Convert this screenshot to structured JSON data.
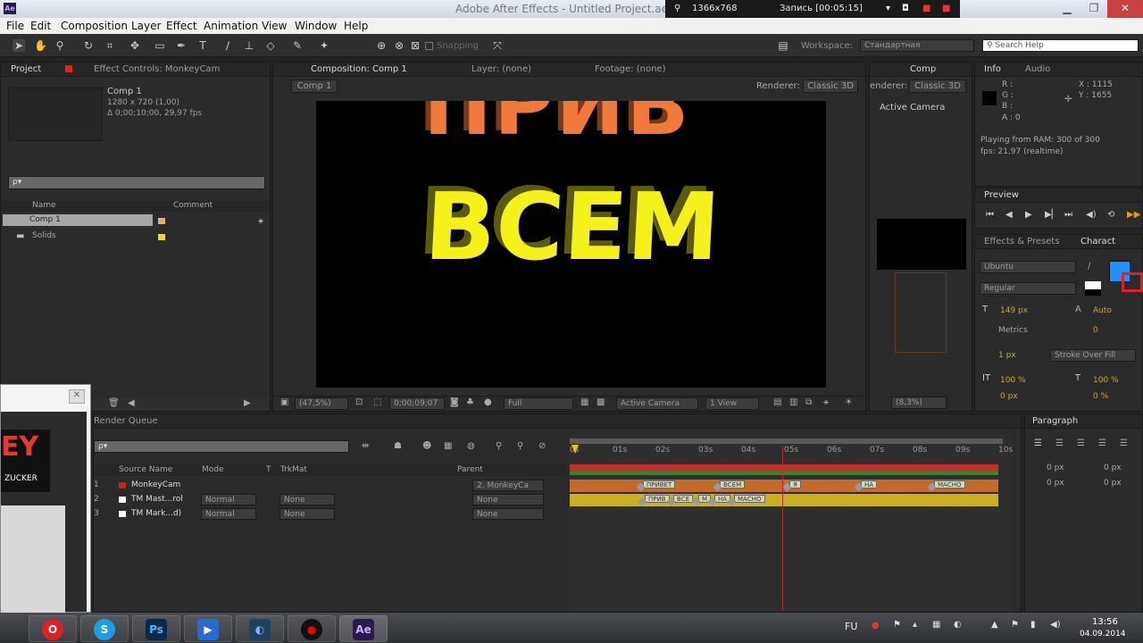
{
  "window": {
    "title": "Adobe After Effects - Untitled Project.aep",
    "app_icon": "Ae"
  },
  "recorder": {
    "resolution": "1366x768",
    "status": "Запись [00:05:15]"
  },
  "menu": [
    "File",
    "Edit",
    "Composition",
    "Layer",
    "Effect",
    "Animation",
    "View",
    "Window",
    "Help"
  ],
  "toolbar": {
    "snapping_label": "Snapping",
    "workspace_label": "Workspace:",
    "workspace_value": "Стандартная",
    "search_placeholder": "Search Help"
  },
  "project": {
    "tab": "Project",
    "tab2": "Effect Controls: MonkeyCam",
    "comp_name": "Comp 1",
    "comp_size": "1280 x 720 (1,00)",
    "comp_duration": "Δ 0;00;10;00, 29,97 fps",
    "search_placeholder": "ρ▾",
    "col_name": "Name",
    "col_comment": "Comment",
    "items": [
      "Comp 1",
      "Solids"
    ]
  },
  "comp": {
    "tab": "Composition: Comp 1",
    "tab_layer": "Layer: (none)",
    "tab_footage": "Footage: (none)",
    "subtab": "Comp 1",
    "renderer_label": "Renderer:",
    "renderer_value": "Classic 3D",
    "text_top": "ПРИВ",
    "text_main": "ВСЕМ",
    "zoom": "(47,5%)",
    "timecode": "0;00;09;07",
    "resolution": "Full",
    "view": "Active Camera",
    "views": "1 View"
  },
  "comp2": {
    "tab": "Comp",
    "renderer_label": "enderer:",
    "renderer_value": "Classic 3D",
    "camera": "Active Camera",
    "zoom": "(8,3%)"
  },
  "info": {
    "tab": "Info",
    "tab2": "Audio",
    "r": "R :",
    "g": "G :",
    "b": "B :",
    "a": "A : 0",
    "x": "X : 1115",
    "y": "Y : 1655",
    "status1": "Playing from RAM: 300 of 300",
    "status2": "fps: 21,97 (realtime)"
  },
  "preview": {
    "tab": "Preview"
  },
  "character": {
    "tab": "Effects & Presets",
    "tab2": "Charact",
    "font": "Ubuntu",
    "style": "Regular",
    "size": "149 px",
    "leading": "Auto",
    "kerning": "Metrics",
    "tracking": "0",
    "stroke": "1 px",
    "stroke_type": "Stroke Over Fill",
    "vscale": "100 %",
    "hscale": "100 %",
    "baseline": "0 px",
    "tsume": "0 %",
    "fill_color": "#1e90ff",
    "stroke_color": "#e02020"
  },
  "paragraph": {
    "tab": "Paragraph",
    "indent1": "0 px",
    "indent2": "0 px",
    "indent3": "0 px",
    "indent4": "0 px"
  },
  "render_queue": {
    "tab": "Render Queue",
    "search_placeholder": "ρ▾"
  },
  "timeline": {
    "col_source": "Source Name",
    "col_mode": "Mode",
    "col_t": "T",
    "col_trkmat": "TrkMat",
    "col_parent": "Parent",
    "layers": [
      {
        "num": "1",
        "name": "MonkeyCam",
        "mode": "",
        "trkmat": "",
        "parent": "2. MonkeyCa",
        "color": "#b02a2a"
      },
      {
        "num": "2",
        "name": "TM Mast...rol",
        "mode": "Normal",
        "trkmat": "None",
        "parent": "None",
        "color": "#c8761b"
      },
      {
        "num": "3",
        "name": "TM Mark...d)",
        "mode": "Normal",
        "trkmat": "None",
        "parent": "None",
        "color": "#c8b021"
      }
    ],
    "ruler": [
      "0s",
      "01s",
      "02s",
      "03s",
      "04s",
      "05s",
      "06s",
      "07s",
      "08s",
      "09s",
      "10s"
    ],
    "markers2": [
      "ПРИВЕТ",
      "ВСЕМ",
      "Я",
      "НА",
      "МАСНО"
    ],
    "markers3": [
      "ПРИВ",
      "ВСЕ",
      "М",
      "НА",
      "МАСНО"
    ]
  },
  "overlay": {
    "logo_text": "EY",
    "logo_sub": "ZUCKER"
  },
  "taskbar": {
    "lang": "FU",
    "time": "13:56",
    "date": "04.09.2014",
    "apps": [
      "Opera",
      "Skype",
      "Ps",
      "Media",
      "Bandicam",
      "Recorder",
      "Ae"
    ]
  }
}
